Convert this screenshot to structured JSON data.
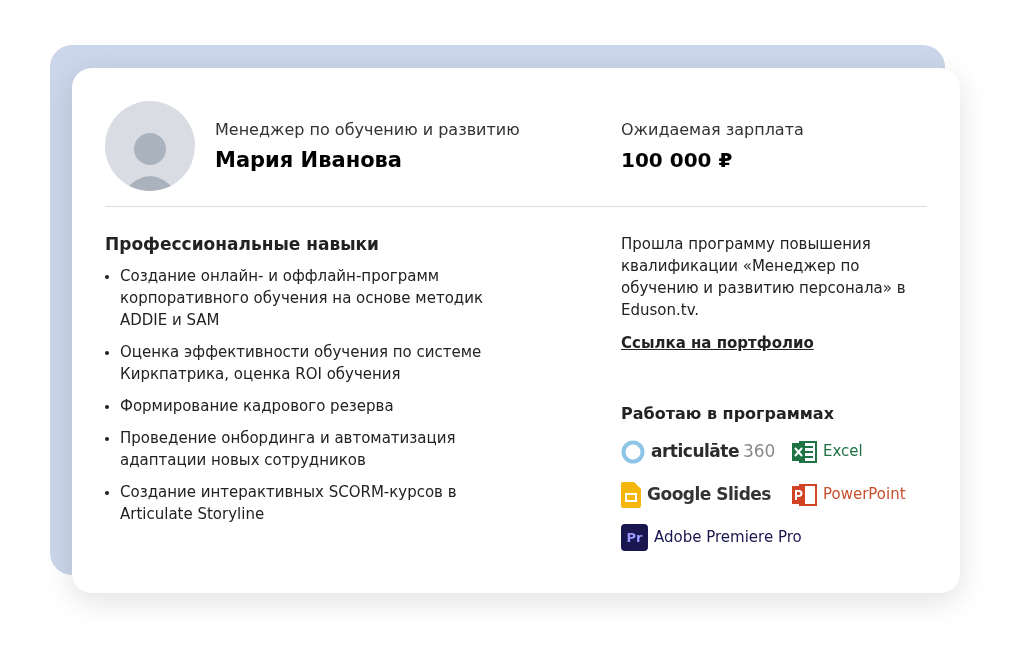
{
  "profile": {
    "position": "Менеджер по обучению и развитию",
    "name": "Мария Иванова"
  },
  "salary": {
    "label": "Ожидаемая зарплата",
    "value": "100 000 ₽"
  },
  "skills": {
    "title": "Профессиональные навыки",
    "items": [
      "Создание онлайн- и оффлайн-программ корпоративного обучения на основе методик ADDIE и SAM",
      "Оценка эффективности обучения по системе Киркпатрика, оценка ROI обучения",
      "Формирование кадрового резерва",
      "Проведение онбординга и автоматизация адаптации новых сотрудников",
      "Создание интерактивных SCORM-курсов в Articulate Storyline"
    ]
  },
  "course_note": "Прошла программу повышения квалификации «Менеджер по обучению и развитию персонала» в Eduson.tv.",
  "portfolio_link": "Ссылка на портфолио",
  "software": {
    "title": "Работаю в программах",
    "apps": [
      {
        "kind": "articulate",
        "name": "articulāte",
        "suffix": "360"
      },
      {
        "kind": "excel",
        "name": "Excel"
      },
      {
        "kind": "slides",
        "name": "Google Slides"
      },
      {
        "kind": "powerpoint",
        "name": "PowerPoint"
      },
      {
        "kind": "premiere",
        "badge": "Pr",
        "name": "Adobe Premiere Pro"
      }
    ]
  }
}
